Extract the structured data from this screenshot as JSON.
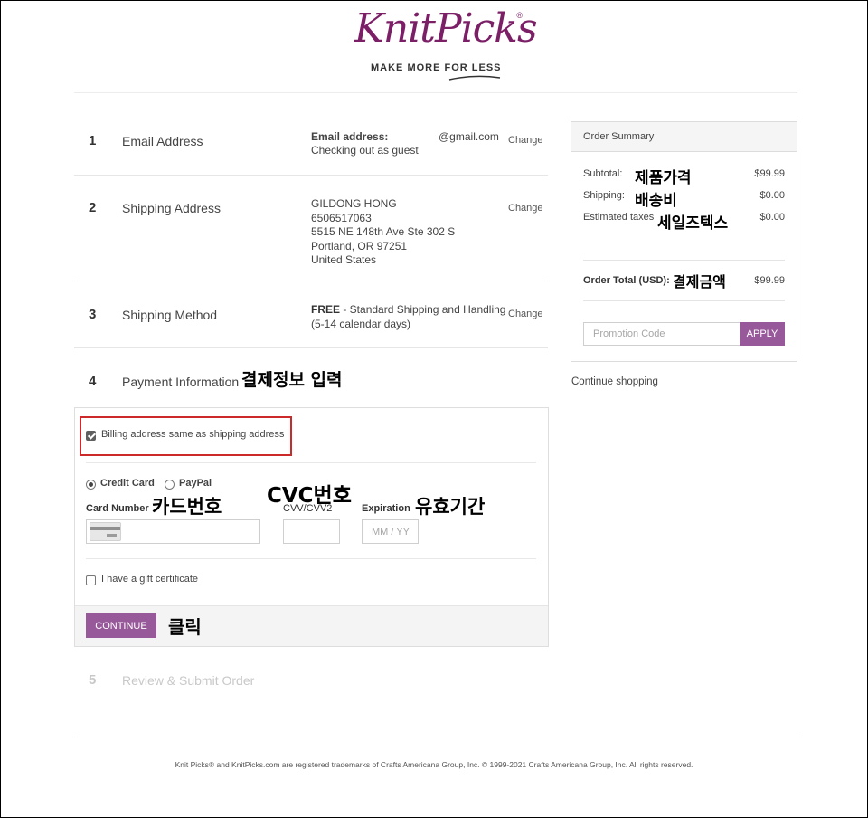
{
  "header": {
    "logo_text": "KnitPicks",
    "logo_reg": "®",
    "tagline": "MAKE MORE FOR LESS"
  },
  "steps": [
    {
      "number": "1",
      "title": "Email Address",
      "detail_label": "Email address:",
      "detail_value": "@gmail.com",
      "detail_sub": "Checking out as guest",
      "change": "Change"
    },
    {
      "number": "2",
      "title": "Shipping Address",
      "lines": [
        "GILDONG HONG",
        "6506517063",
        "5515 NE 148th Ave Ste 302 S",
        "Portland, OR 97251",
        "United States"
      ],
      "change": "Change"
    },
    {
      "number": "3",
      "title": "Shipping Method",
      "detail_bold": "FREE",
      "detail_rest": " - Standard Shipping and Handling",
      "detail_sub": "(5-14 calendar days)",
      "change": "Change"
    },
    {
      "number": "4",
      "title": "Payment Information"
    },
    {
      "number": "5",
      "title": "Review & Submit Order"
    }
  ],
  "payment": {
    "billing_same_label": "Billing address same as shipping address",
    "billing_same_checked": true,
    "method_credit": "Credit Card",
    "method_paypal": "PayPal",
    "card_number_label": "Card Number",
    "cvv_label": "CVV/CVV2",
    "expiration_label": "Expiration",
    "expiration_placeholder": "MM / YY",
    "gift_label": "I have a gift certificate",
    "continue_label": "CONTINUE"
  },
  "summary": {
    "title": "Order Summary",
    "subtotal_label": "Subtotal:",
    "subtotal_value": "$99.99",
    "shipping_label": "Shipping:",
    "shipping_value": "$0.00",
    "taxes_label": "Estimated taxes",
    "taxes_value": "$0.00",
    "total_label": "Order Total (USD):",
    "total_value": "$99.99",
    "promo_placeholder": "Promotion Code",
    "apply_label": "APPLY",
    "continue_shopping": "Continue shopping"
  },
  "annotations": {
    "subtotal": "제품가격",
    "shipping": "배송비",
    "tax": "세일즈텍스",
    "total": "결제금액",
    "payment_info": "결제정보 입력",
    "card_number": "카드번호",
    "cvc": "CVC번호",
    "expiration": "유효기간",
    "click": "클릭"
  },
  "footer": {
    "text": "Knit Picks® and KnitPicks.com are registered trademarks of Crafts Americana Group, Inc. © 1999-2021 Crafts Americana Group, Inc. All rights reserved."
  },
  "colors": {
    "brand": "#7b1f66",
    "button": "#97599a",
    "highlight_box": "#cc2a2a"
  }
}
